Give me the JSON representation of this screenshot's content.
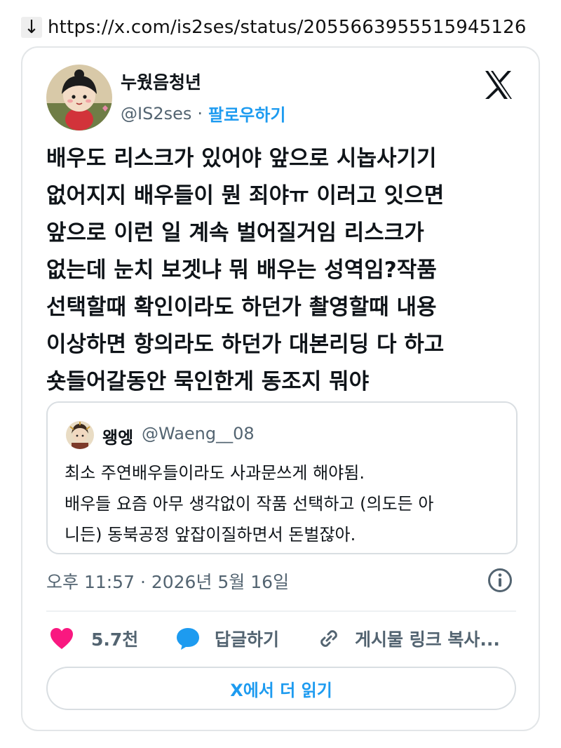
{
  "url_bar": {
    "arrow": "↓",
    "url": "https://x.com/is2ses/status/2055663955515945126"
  },
  "author": {
    "avatar_icon": "avatar-character",
    "name": "누웠음청년",
    "handle": "@IS2ses",
    "separator": "·",
    "follow_label": "팔로우하기"
  },
  "logo_icon": "x-logo-icon",
  "tweet": {
    "text": "배우도 리스크가 있어야 앞으로 시놉사기기\n없어지지 배우들이 뭔 죄야ㅠ 이러고 잇으면\n앞으로 이런 일 계속 벌어질거임 리스크가\n없는데 눈치 보겟냐 뭐 배우는 성역임?작품\n선택할때 확인이라도 하던가 촬영할때 내용\n이상하면 항의라도 하던가 대본리딩 다 하고\n숏들어갈동안 묵인한게 동조지 뭐야"
  },
  "quote": {
    "name": "왱엥",
    "handle": "@Waeng__08",
    "text": "최소 주연배우들이라도 사과문쓰게 해야됨.\n배우들 요즘 아무 생각없이 작품 선택하고 (의도든 아\n니든) 동북공정 앞잡이질하면서 돈벌잖아."
  },
  "timestamp": "오후 11:57 · 2026년 5월 16일",
  "actions": {
    "like_count": "5.7천",
    "reply_label": "답글하기",
    "copy_label": "게시물 링크 복사..."
  },
  "read_more": "X에서 더 읽기",
  "colors": {
    "accent": "#1d9bf0",
    "like": "#f91880",
    "text": "#0f1419",
    "muted": "#536471",
    "border": "#e3e6e8"
  }
}
